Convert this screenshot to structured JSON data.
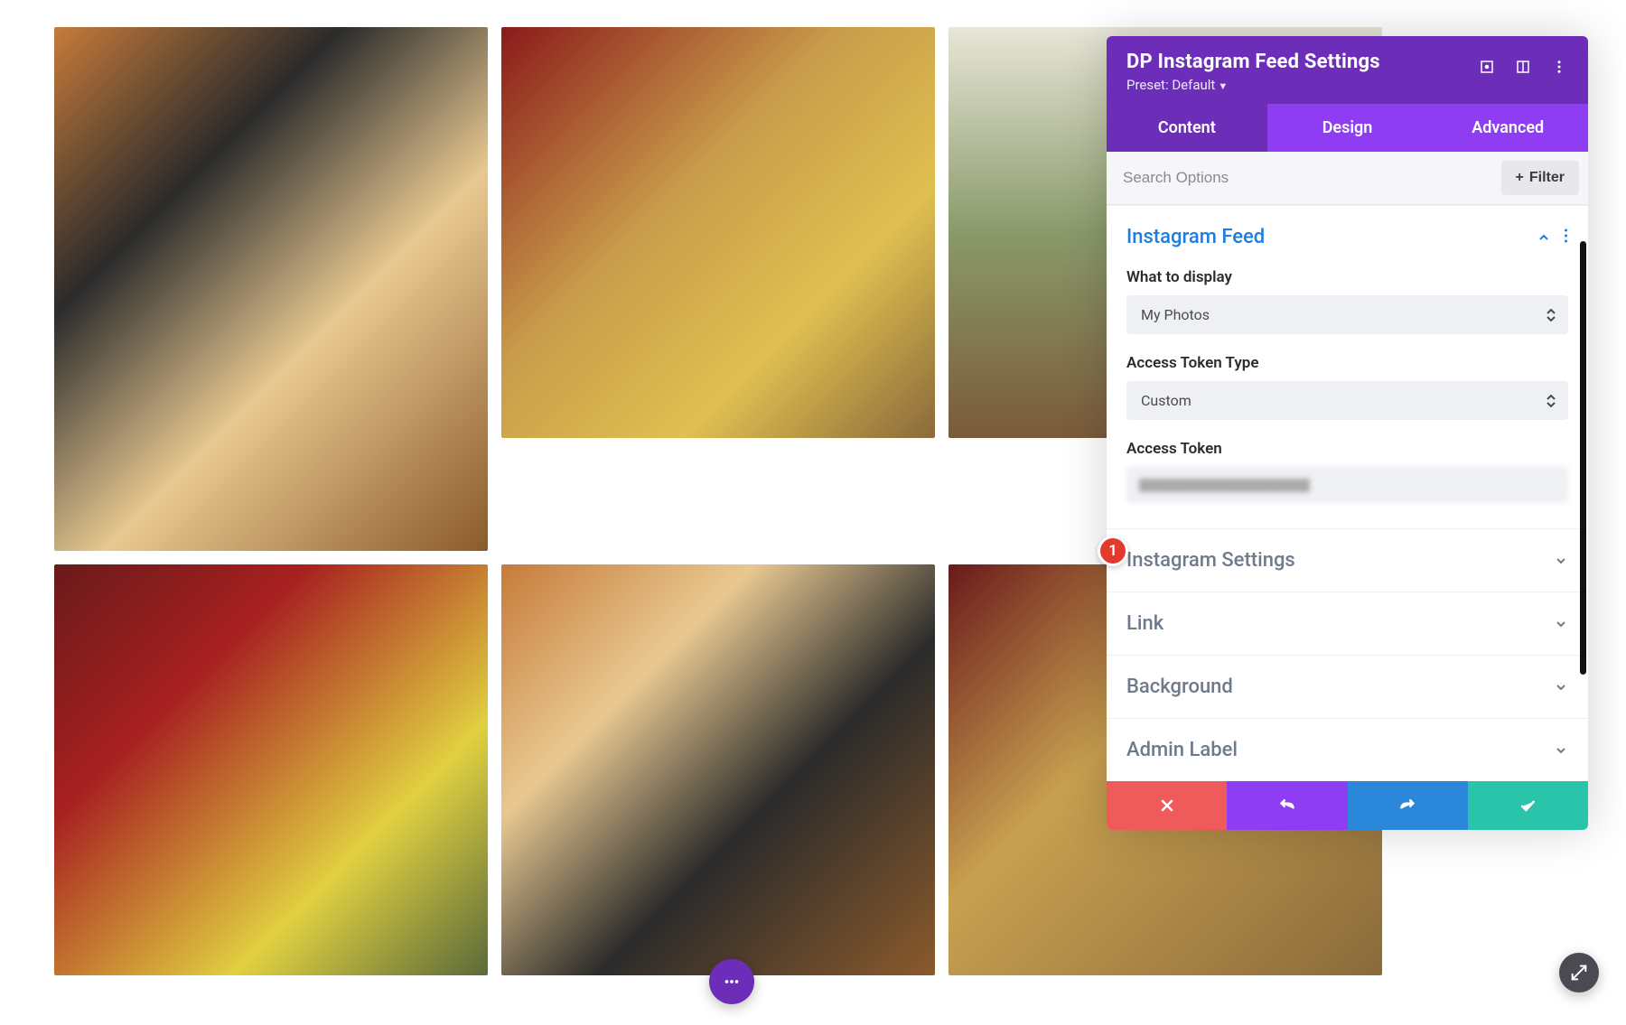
{
  "panel": {
    "title": "DP Instagram Feed Settings",
    "preset_label": "Preset: Default",
    "tabs": [
      "Content",
      "Design",
      "Advanced"
    ],
    "active_tab": 0,
    "search_placeholder": "Search Options",
    "filter_btn": "Filter"
  },
  "sections": {
    "instagram_feed": {
      "title": "Instagram Feed",
      "what_label": "What to display",
      "what_value": "My Photos",
      "token_type_label": "Access Token Type",
      "token_type_value": "Custom",
      "token_label": "Access Token"
    },
    "instagram_settings": {
      "title": "Instagram Settings"
    },
    "link": {
      "title": "Link"
    },
    "background": {
      "title": "Background"
    },
    "admin_label": {
      "title": "Admin Label"
    }
  },
  "badge": {
    "one": "1"
  }
}
